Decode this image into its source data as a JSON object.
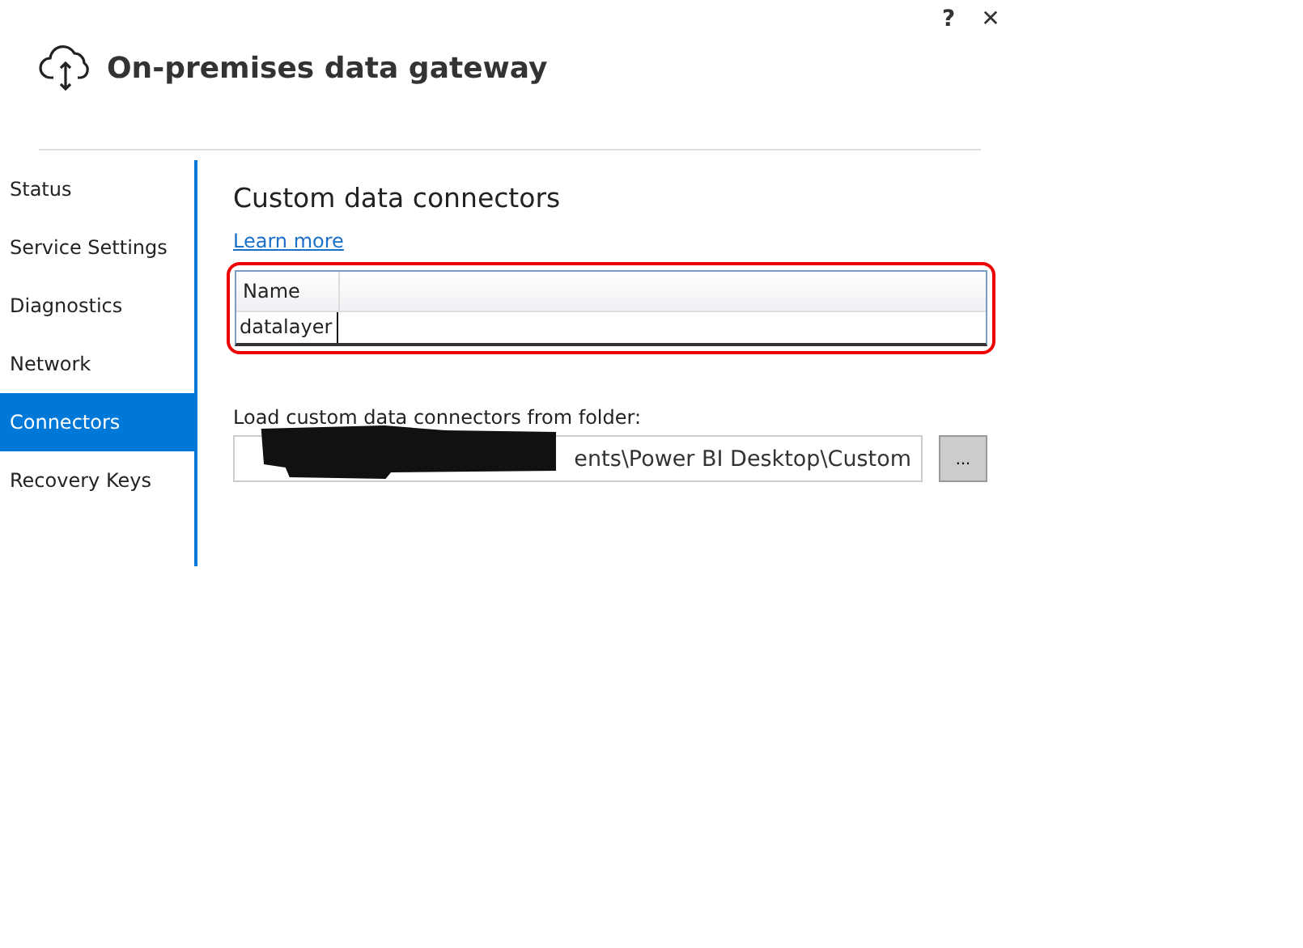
{
  "window": {
    "title": "On-premises data gateway",
    "help": "?",
    "close": "✕"
  },
  "sidebar": {
    "items": [
      {
        "label": "Status",
        "selected": false
      },
      {
        "label": "Service Settings",
        "selected": false
      },
      {
        "label": "Diagnostics",
        "selected": false
      },
      {
        "label": "Network",
        "selected": false
      },
      {
        "label": "Connectors",
        "selected": true
      },
      {
        "label": "Recovery Keys",
        "selected": false
      }
    ]
  },
  "content": {
    "heading": "Custom data connectors",
    "link": "Learn more",
    "table": {
      "columns": [
        "Name"
      ],
      "rows": [
        [
          "datalayer"
        ]
      ],
      "highlighted": true
    },
    "folder": {
      "label": "Load custom data connectors from folder:",
      "value": "ents\\Power BI Desktop\\Custom",
      "redacted": true,
      "browse": "..."
    }
  }
}
